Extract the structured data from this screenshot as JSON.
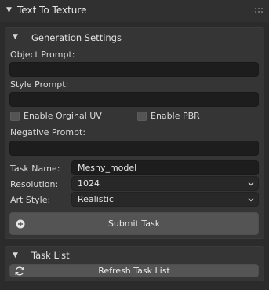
{
  "panel": {
    "title": "Text To Texture"
  },
  "generation": {
    "title": "Generation Settings",
    "object_prompt_label": "Object Prompt:",
    "object_prompt_value": "",
    "style_prompt_label": "Style Prompt:",
    "style_prompt_value": "",
    "enable_uv_label": "Enable Orginal UV",
    "enable_pbr_label": "Enable PBR",
    "negative_prompt_label": "Negative Prompt:",
    "negative_prompt_value": "",
    "task_name_label": "Task Name:",
    "task_name_value": "Meshy_model",
    "resolution_label": "Resolution:",
    "resolution_value": "1024",
    "art_style_label": "Art Style:",
    "art_style_value": "Realistic",
    "submit_label": "Submit Task"
  },
  "tasks": {
    "title": "Task List",
    "refresh_label": "Refresh Task List"
  },
  "icons": {
    "panel_collapse": "triangle-down-icon",
    "grip": "drag-grip-icon",
    "add": "plus-circle-icon",
    "refresh": "refresh-icon",
    "dropdown": "chevron-down-icon"
  }
}
